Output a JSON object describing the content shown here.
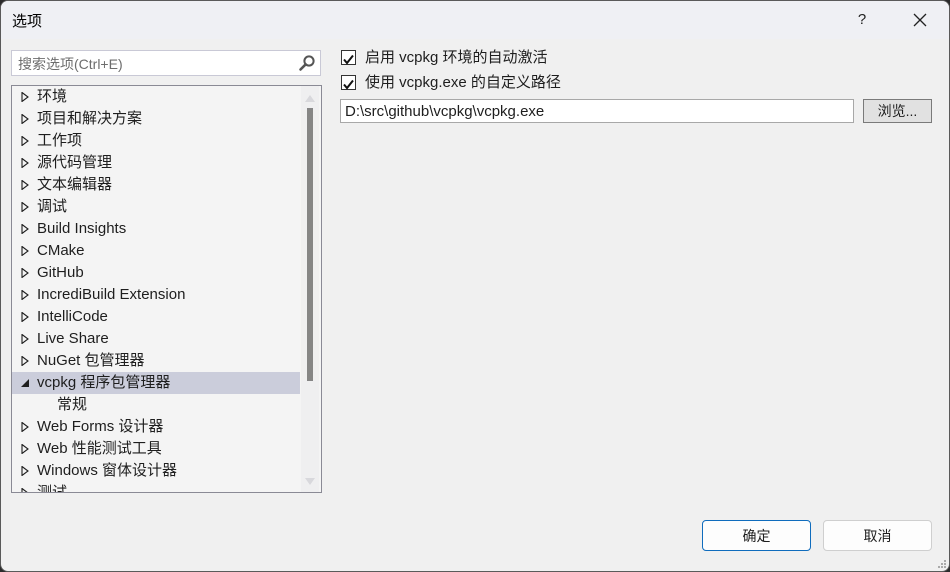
{
  "window": {
    "title": "选项",
    "help_label": "?",
    "close_icon": "close-icon"
  },
  "search": {
    "placeholder": "搜索选项(Ctrl+E)",
    "value": "",
    "icon": "search-icon"
  },
  "tree": {
    "items": [
      {
        "label": "环境",
        "expanded": false,
        "selected": false,
        "level": 0
      },
      {
        "label": "项目和解决方案",
        "expanded": false,
        "selected": false,
        "level": 0
      },
      {
        "label": "工作项",
        "expanded": false,
        "selected": false,
        "level": 0
      },
      {
        "label": "源代码管理",
        "expanded": false,
        "selected": false,
        "level": 0
      },
      {
        "label": "文本编辑器",
        "expanded": false,
        "selected": false,
        "level": 0
      },
      {
        "label": "调试",
        "expanded": false,
        "selected": false,
        "level": 0
      },
      {
        "label": "Build Insights",
        "expanded": false,
        "selected": false,
        "level": 0
      },
      {
        "label": "CMake",
        "expanded": false,
        "selected": false,
        "level": 0
      },
      {
        "label": "GitHub",
        "expanded": false,
        "selected": false,
        "level": 0
      },
      {
        "label": "IncrediBuild Extension",
        "expanded": false,
        "selected": false,
        "level": 0
      },
      {
        "label": "IntelliCode",
        "expanded": false,
        "selected": false,
        "level": 0
      },
      {
        "label": "Live Share",
        "expanded": false,
        "selected": false,
        "level": 0
      },
      {
        "label": "NuGet 包管理器",
        "expanded": false,
        "selected": false,
        "level": 0
      },
      {
        "label": "vcpkg 程序包管理器",
        "expanded": true,
        "selected": true,
        "level": 0
      },
      {
        "label": "常规",
        "expanded": false,
        "selected": false,
        "level": 1
      },
      {
        "label": "Web Forms 设计器",
        "expanded": false,
        "selected": false,
        "level": 0
      },
      {
        "label": "Web 性能测试工具",
        "expanded": false,
        "selected": false,
        "level": 0
      },
      {
        "label": "Windows 窗体设计器",
        "expanded": false,
        "selected": false,
        "level": 0
      },
      {
        "label": "测试",
        "expanded": false,
        "selected": false,
        "level": 0
      }
    ]
  },
  "settings": {
    "auto_activate": {
      "label": "启用 vcpkg 环境的自动激活",
      "checked": true
    },
    "custom_path": {
      "label": "使用 vcpkg.exe 的自定义路径",
      "checked": true
    },
    "path_value": "D:\\src\\github\\vcpkg\\vcpkg.exe",
    "browse_label": "浏览..."
  },
  "footer": {
    "ok_label": "确定",
    "cancel_label": "取消"
  },
  "colors": {
    "accent": "#0f6cbd",
    "selection": "#cbcddb"
  }
}
